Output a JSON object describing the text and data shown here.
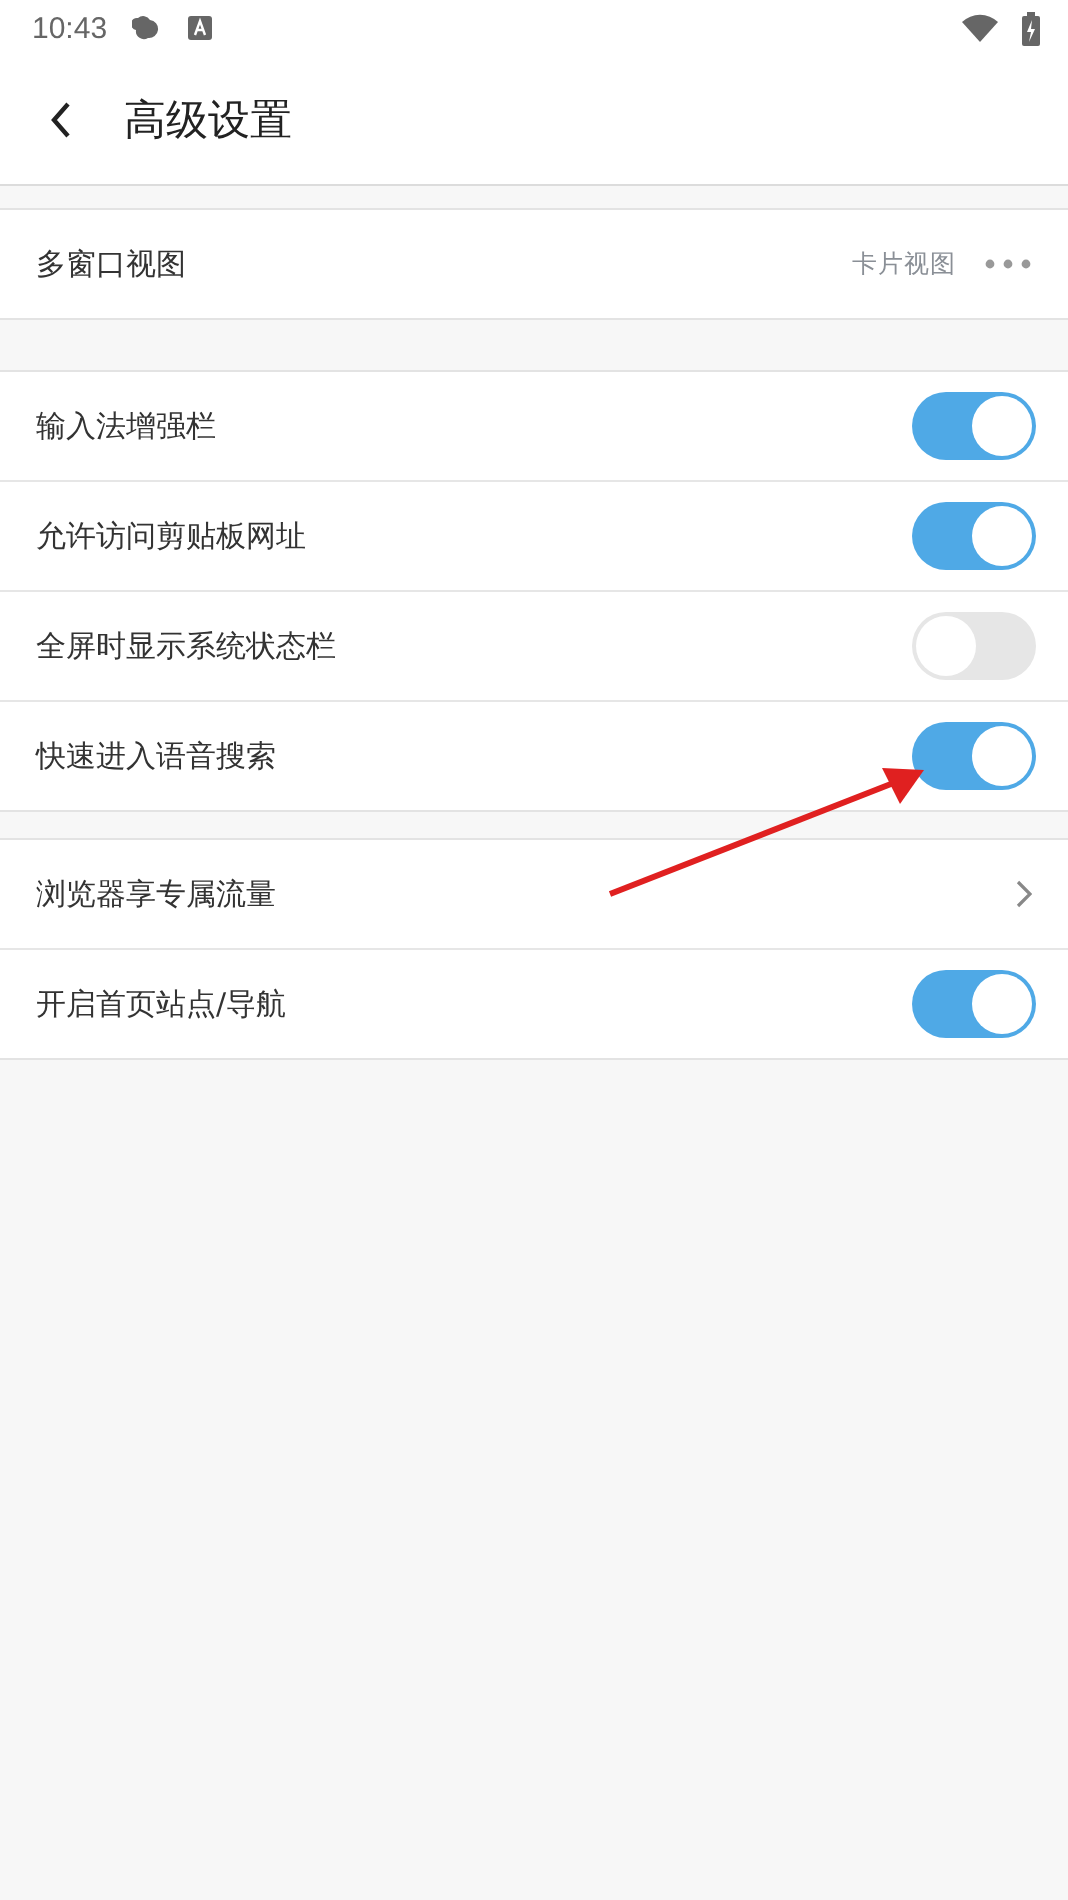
{
  "status_bar": {
    "time": "10:43"
  },
  "header": {
    "title": "高级设置"
  },
  "sections": [
    {
      "rows": [
        {
          "kind": "value",
          "label": "多窗口视图",
          "value": "卡片视图"
        }
      ]
    },
    {
      "rows": [
        {
          "kind": "toggle",
          "label": "输入法增强栏",
          "on": true
        },
        {
          "kind": "toggle",
          "label": "允许访问剪贴板网址",
          "on": true
        },
        {
          "kind": "toggle",
          "label": "全屏时显示系统状态栏",
          "on": false
        },
        {
          "kind": "toggle",
          "label": "快速进入语音搜索",
          "on": true
        }
      ]
    },
    {
      "rows": [
        {
          "kind": "link",
          "label": "浏览器享专属流量"
        },
        {
          "kind": "toggle",
          "label": "开启首页站点/导航",
          "on": true
        }
      ]
    }
  ]
}
